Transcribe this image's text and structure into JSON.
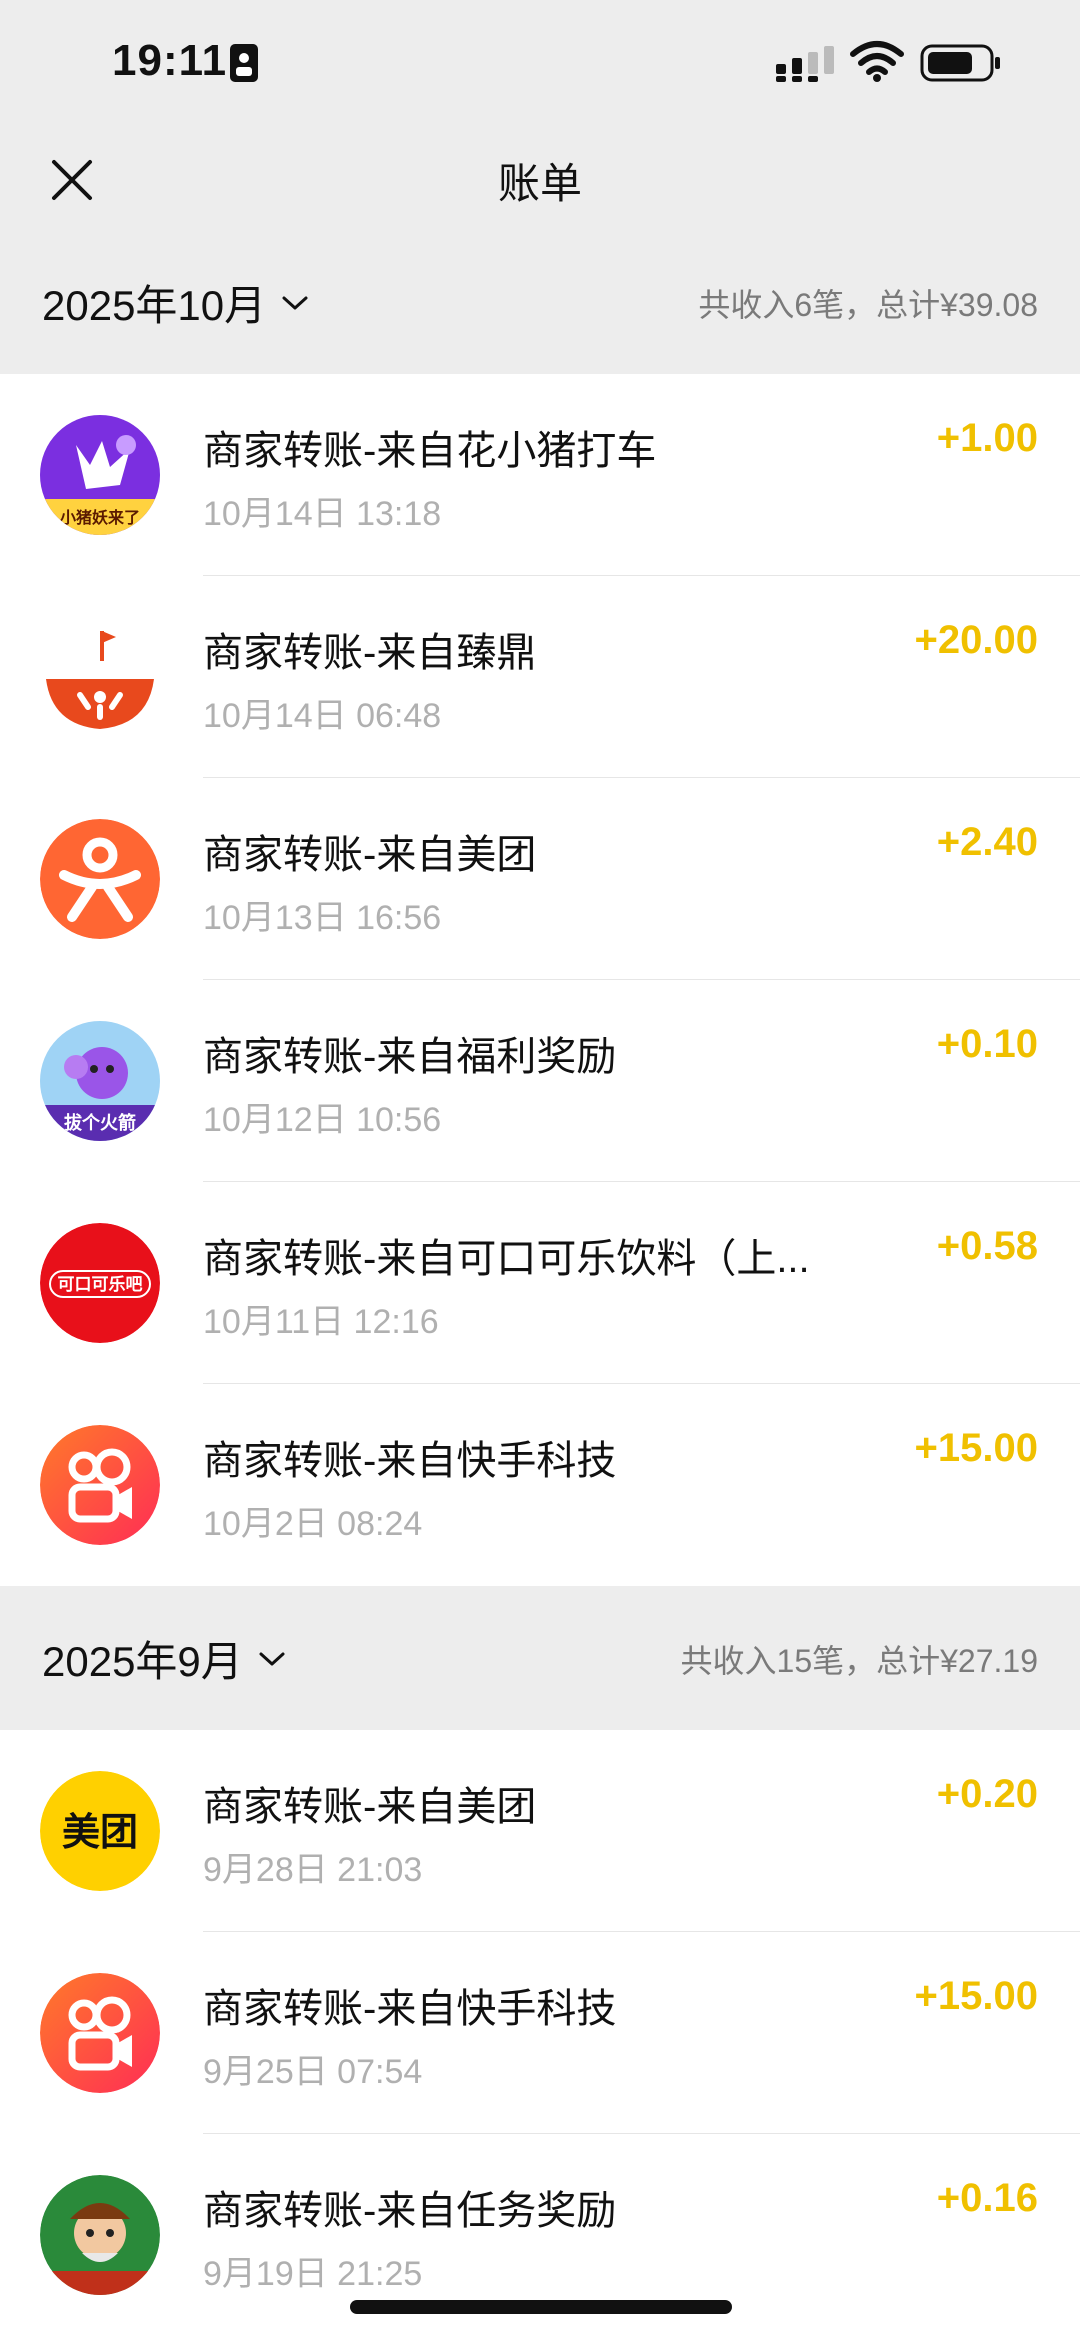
{
  "status_bar": {
    "time": "19:11"
  },
  "nav": {
    "title": "账单"
  },
  "sections": [
    {
      "month": "2025年10月",
      "summary": "共收入6笔，总计¥39.08",
      "items": [
        {
          "title": "商家转账-来自花小猪打车",
          "time": "10月14日 13:18",
          "amount": "+1.00",
          "avatar": "huaxiaozhu-logo",
          "avatar_text": "小猪妖来了"
        },
        {
          "title": "商家转账-来自臻鼎",
          "time": "10月14日 06:48",
          "amount": "+20.00",
          "avatar": "zhending-logo"
        },
        {
          "title": "商家转账-来自美团",
          "time": "10月13日 16:56",
          "amount": "+2.40",
          "avatar": "dianping-logo"
        },
        {
          "title": "商家转账-来自福利奖励",
          "time": "10月12日 10:56",
          "amount": "+0.10",
          "avatar": "fuli-reward-logo",
          "avatar_text": "拔个火箭"
        },
        {
          "title": "商家转账-来自可口可乐饮料（上...",
          "time": "10月11日 12:16",
          "amount": "+0.58",
          "avatar": "cocacola-logo",
          "avatar_text": "可口可乐吧"
        },
        {
          "title": "商家转账-来自快手科技",
          "time": "10月2日 08:24",
          "amount": "+15.00",
          "avatar": "kuaishou-logo"
        }
      ]
    },
    {
      "month": "2025年9月",
      "summary": "共收入15笔，总计¥27.19",
      "items": [
        {
          "title": "商家转账-来自美团",
          "time": "9月28日 21:03",
          "amount": "+0.20",
          "avatar": "meituan-logo",
          "avatar_text": "美团"
        },
        {
          "title": "商家转账-来自快手科技",
          "time": "9月25日 07:54",
          "amount": "+15.00",
          "avatar": "kuaishou-logo"
        },
        {
          "title": "商家转账-来自任务奖励",
          "time": "9月19日 21:25",
          "amount": "+0.16",
          "avatar": "task-reward-logo"
        }
      ]
    }
  ],
  "colors": {
    "amount": "#f0c000",
    "background": "#ededed"
  }
}
